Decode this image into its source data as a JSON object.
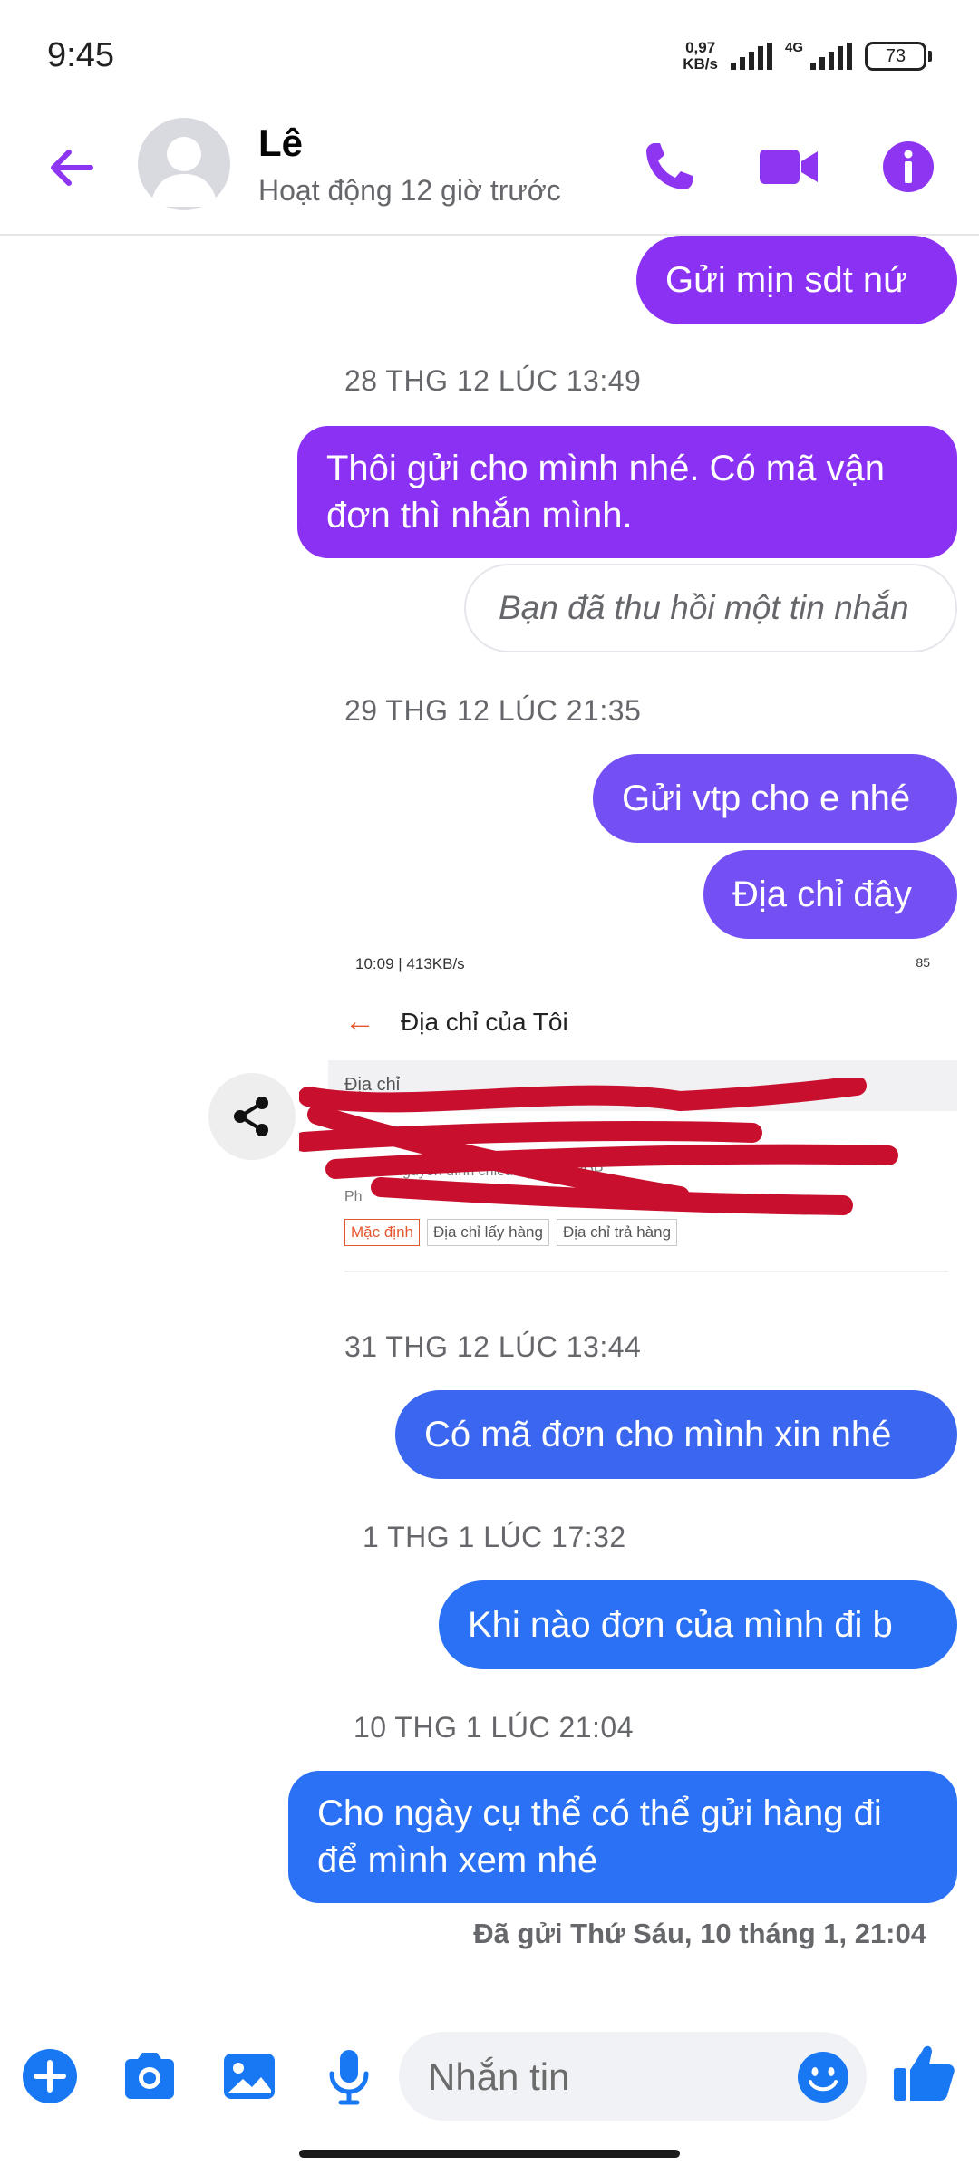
{
  "status_bar": {
    "time": "9:45",
    "speed_value": "0,97",
    "speed_unit": "KB/s",
    "network": "4G",
    "battery": "73"
  },
  "header": {
    "name": "Lê",
    "status": "Hoạt động 12 giờ trước",
    "icons": [
      "back-arrow-icon",
      "phone-icon",
      "video-icon",
      "info-icon"
    ],
    "accent": "#8e35f1"
  },
  "messages": [
    {
      "text": "Gửi mịn sdt nứ"
    },
    {
      "timestamp": "28 THG 12 LÚC 13:49"
    },
    {
      "text": "Thôi gửi cho mình nhé. Có mã vận đơn thì nhắn mình."
    },
    {
      "text": "Bạn đã thu hồi một tin nhắn"
    },
    {
      "timestamp": "29 THG 12 LÚC 21:35"
    },
    {
      "text": "Gửi vtp cho e nhé"
    },
    {
      "text": "Địa chỉ đây"
    },
    {
      "timestamp": "31 THG 12 LÚC 13:44"
    },
    {
      "text": "Có mã đơn cho mình xin nhé"
    },
    {
      "timestamp": "1 THG 1 LÚC 17:32"
    },
    {
      "text": "Khi nào đơn của mình đi b"
    },
    {
      "timestamp": "10 THG 1 LÚC 21:04"
    },
    {
      "text": "Cho ngày cụ thể có thể gửi hàng đi để mình xem nhé"
    }
  ],
  "attachment": {
    "status_left": "10:09 | 413KB/s",
    "status_right": "85",
    "title": "Địa chỉ của Tôi",
    "section": "Địa chỉ",
    "row1": "Ph",
    "row2": "Sn 4 ... nguyễn đình chiểu ngõ đầu PDP",
    "row3": "Ph",
    "tags": [
      "Mặc định",
      "Địa chỉ lấy hàng",
      "Địa chỉ trả hàng"
    ]
  },
  "seen_text": "Đã gửi Thứ Sáu, 10 tháng 1, 21:04",
  "composer": {
    "placeholder": "Nhắn tin",
    "icons": [
      "plus-icon",
      "camera-icon",
      "gallery-icon",
      "mic-icon",
      "emoji-icon",
      "thumbs-up-icon"
    ]
  }
}
